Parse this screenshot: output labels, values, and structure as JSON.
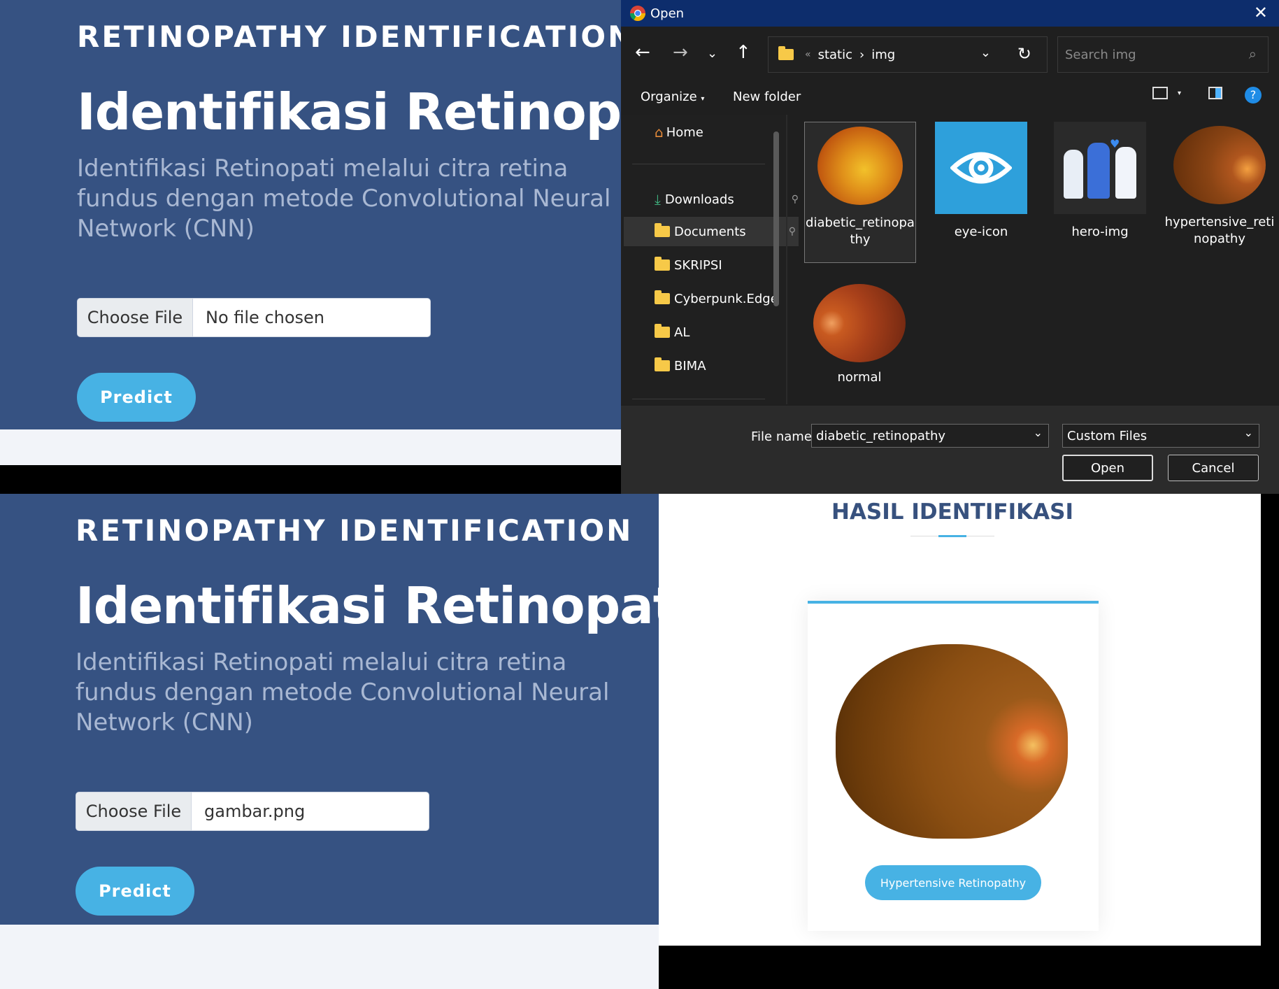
{
  "top_app": {
    "eyebrow": "RETINOPATHY IDENTIFICATION",
    "title": "Identifikasi Retinopati",
    "subtitle": "Identifikasi Retinopati melalui citra retina fundus dengan metode Convolutional Neural Network (CNN)",
    "choose_file_label": "Choose File",
    "file_status": "No file chosen",
    "predict_label": "Predict"
  },
  "dialog": {
    "title": "Open",
    "breadcrumb": {
      "overflow": "«",
      "items": [
        "static",
        "img"
      ],
      "separator": "›"
    },
    "search_placeholder": "Search img",
    "organize_label": "Organize",
    "new_folder_label": "New folder",
    "sidebar": [
      {
        "label": "Home",
        "icon": "home-icon"
      },
      {
        "label": "Downloads",
        "icon": "download-icon",
        "pinned": true
      },
      {
        "label": "Documents",
        "icon": "folder-icon",
        "pinned": true,
        "selected": true
      },
      {
        "label": "SKRIPSI",
        "icon": "folder-icon"
      },
      {
        "label": "Cyberpunk.Edge",
        "icon": "folder-icon"
      },
      {
        "label": "AL",
        "icon": "folder-icon"
      },
      {
        "label": "BIMA",
        "icon": "folder-icon"
      }
    ],
    "files": [
      {
        "name_line1": "diabetic_retinopa",
        "name_line2": "thy",
        "selected": true
      },
      {
        "name_line1": "eye-icon",
        "name_line2": ""
      },
      {
        "name_line1": "hero-img",
        "name_line2": ""
      },
      {
        "name_line1": "hypertensive_reti",
        "name_line2": "nopathy"
      },
      {
        "name_line1": "normal",
        "name_line2": ""
      }
    ],
    "file_name_label": "File name:",
    "file_name_value": "diabetic_retinopathy",
    "file_type_value": "Custom Files",
    "open_label": "Open",
    "cancel_label": "Cancel"
  },
  "bottom_app": {
    "eyebrow": "RETINOPATHY IDENTIFICATION",
    "title": "Identifikasi Retinopati",
    "subtitle": "Identifikasi Retinopati melalui citra retina fundus dengan metode Convolutional Neural Network (CNN)",
    "choose_file_label": "Choose File",
    "file_status": "gambar.png",
    "predict_label": "Predict"
  },
  "result": {
    "heading": "HASIL IDENTIFIKASI",
    "prediction": "Hypertensive Retinopathy"
  },
  "colors": {
    "hero_bg": "#365282",
    "accent": "#47b2e4",
    "dialog_title": "#0d2d6c",
    "heading": "#37517e"
  }
}
